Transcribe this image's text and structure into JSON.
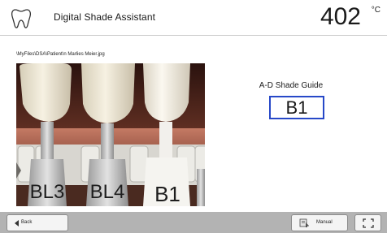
{
  "header": {
    "title": "Digital Shade Assistant",
    "icon": "tooth-icon",
    "temperature": "402",
    "temperature_unit": "°C"
  },
  "content": {
    "file_path": "\\MyFiles\\DSA\\Patient\\n Marlies Meier.jpg",
    "shade_guide_label": "A-D Shade Guide",
    "shade_value": "B1",
    "photo": {
      "tab_labels": [
        "BL3",
        "BL4",
        "B1"
      ]
    },
    "accent_color": "#2748c8"
  },
  "bottombar": {
    "back_label": "Back",
    "back_icon": "triangle-left-icon",
    "manual_label": "Manual",
    "manual_icon": "manual-icon",
    "fullscreen_icon": "fullscreen-icon"
  }
}
